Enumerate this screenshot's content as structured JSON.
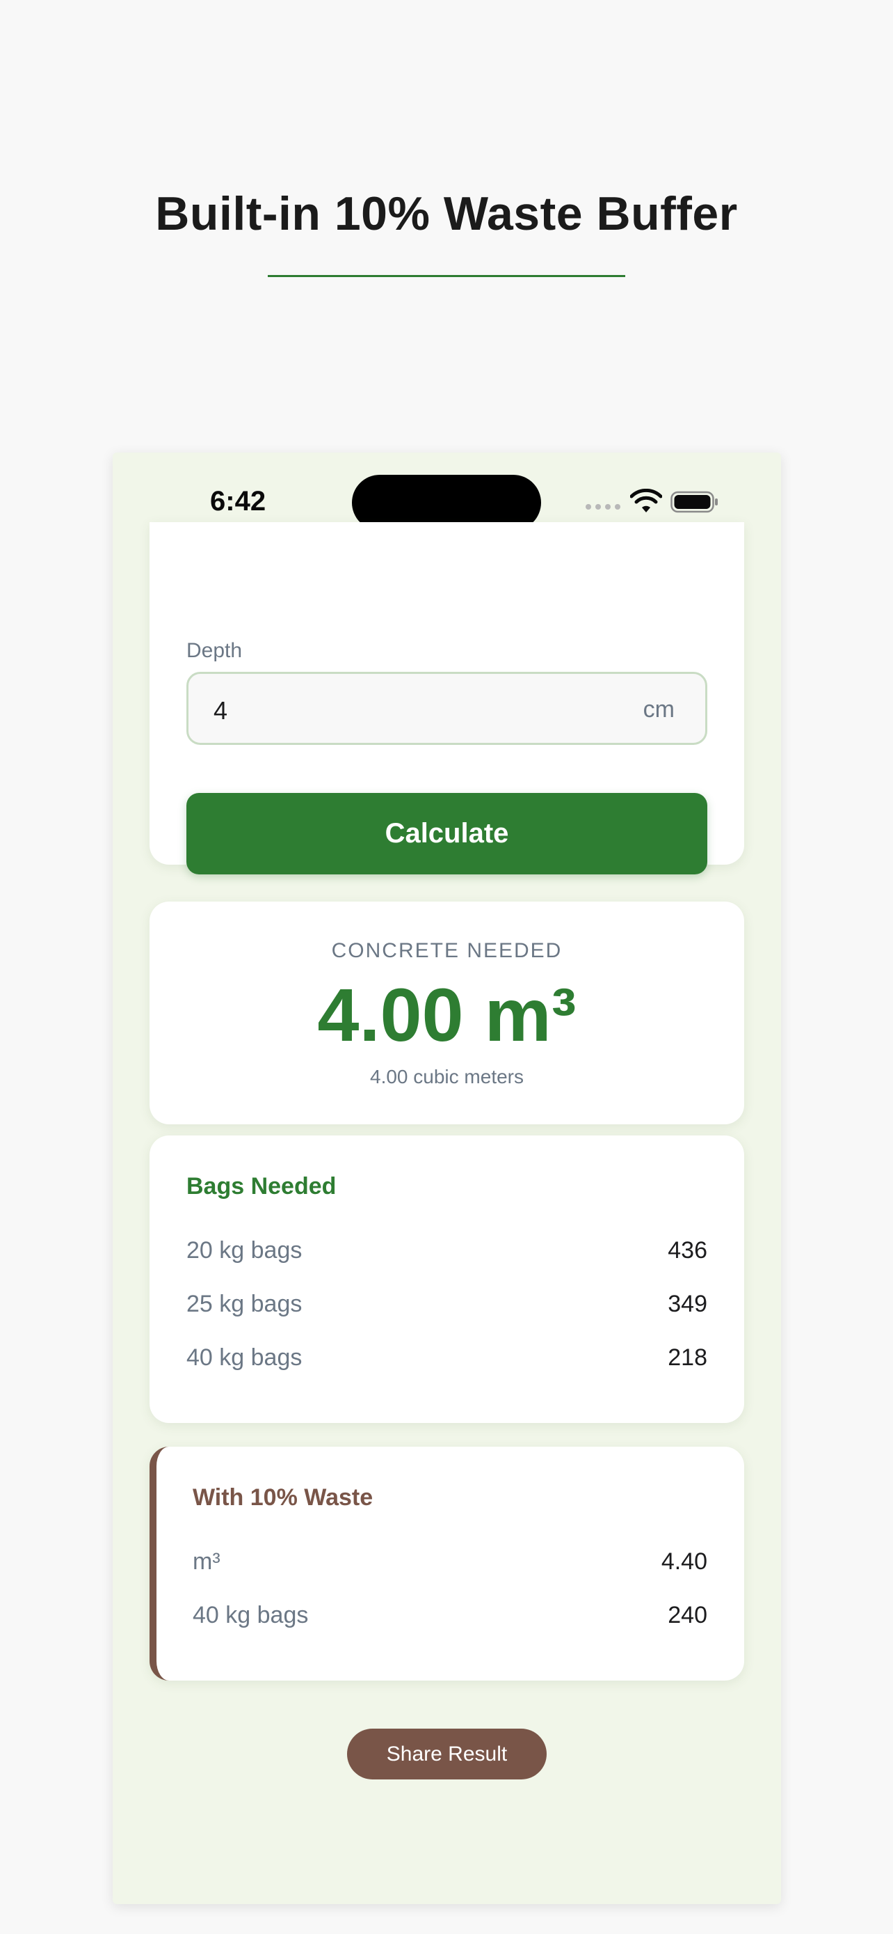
{
  "headline": "Built-in 10% Waste Buffer",
  "status_bar": {
    "time": "6:42"
  },
  "form": {
    "depth_label": "Depth",
    "depth_value": "4",
    "depth_unit": "cm",
    "calculate_label": "Calculate"
  },
  "result": {
    "title": "CONCRETE NEEDED",
    "value": "4.00 m³",
    "subtitle": "4.00 cubic meters"
  },
  "bags": {
    "title": "Bags Needed",
    "rows": [
      {
        "label": "20 kg bags",
        "value": "436"
      },
      {
        "label": "25 kg bags",
        "value": "349"
      },
      {
        "label": "40 kg bags",
        "value": "218"
      }
    ]
  },
  "waste": {
    "title": "With 10% Waste",
    "rows": [
      {
        "label": "m³",
        "value": "4.40"
      },
      {
        "label": "40 kg bags",
        "value": "240"
      }
    ]
  },
  "share_label": "Share Result",
  "colors": {
    "accent_green": "#2e7d32",
    "accent_brown": "#795548",
    "phone_background": "#f1f6e9"
  },
  "icons": [
    "signal-icon",
    "wifi-icon",
    "battery-icon"
  ]
}
